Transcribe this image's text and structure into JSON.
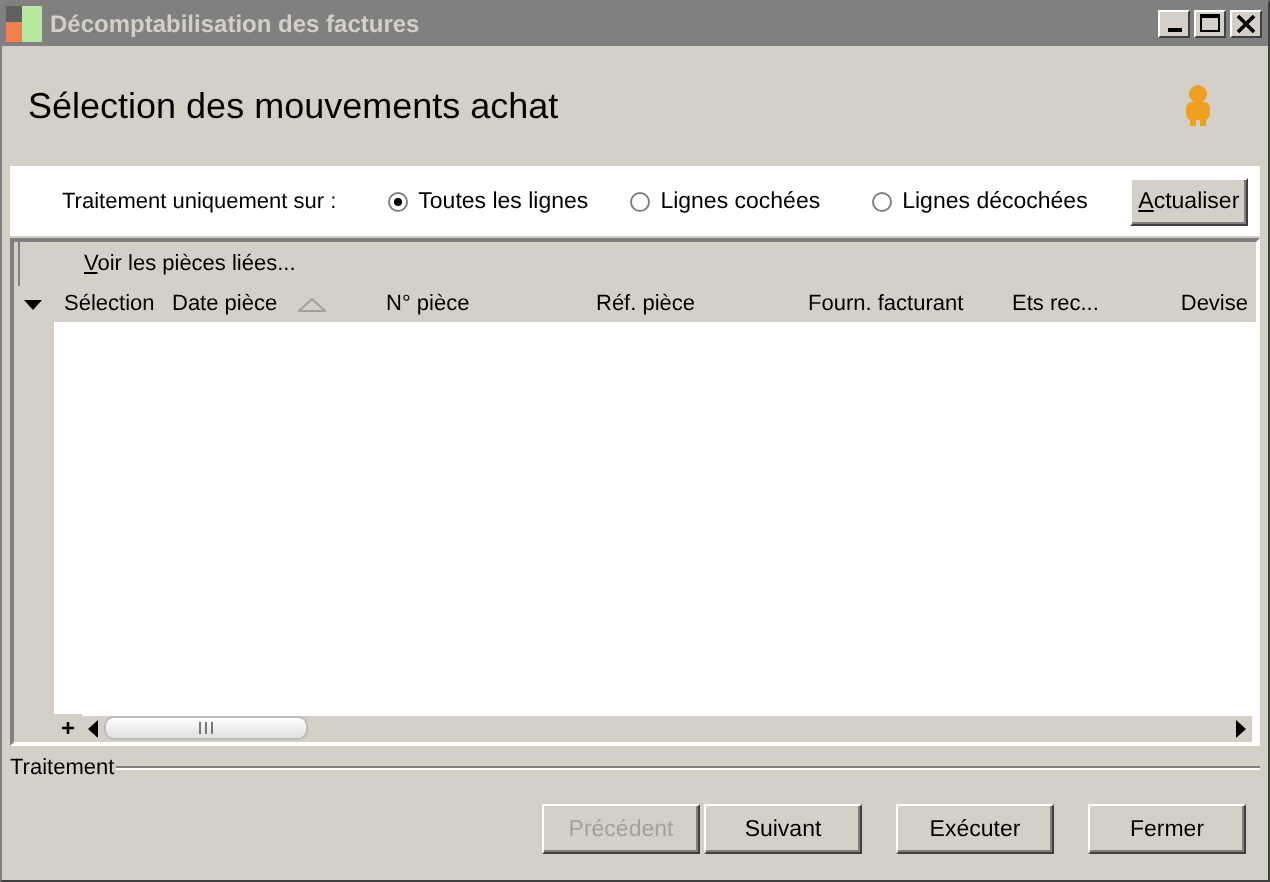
{
  "window": {
    "title": "Décomptabilisation des factures"
  },
  "header": {
    "title": "Sélection des mouvements achat"
  },
  "filter": {
    "label": "Traitement uniquement sur :",
    "options": [
      {
        "label": "Toutes les lignes",
        "selected": true
      },
      {
        "label": "Lignes cochées",
        "selected": false
      },
      {
        "label": "Lignes décochées",
        "selected": false
      }
    ],
    "refresh_button": "Actualiser"
  },
  "grid": {
    "toolbar_link": "Voir les pièces liées...",
    "columns": [
      {
        "label": "Sélection",
        "sorted": false
      },
      {
        "label": "Date pièce",
        "sorted": true
      },
      {
        "label": "N° pièce",
        "sorted": false
      },
      {
        "label": "Réf. pièce",
        "sorted": false
      },
      {
        "label": "Fourn. facturant",
        "sorted": false
      },
      {
        "label": "Ets rec...",
        "sorted": false
      },
      {
        "label": "Devise",
        "sorted": false
      }
    ],
    "add_button": "+"
  },
  "footer": {
    "group_label": "Traitement",
    "buttons": [
      {
        "label": "Précédent",
        "disabled": true
      },
      {
        "label": "Suivant",
        "disabled": false
      },
      {
        "label": "Exécuter",
        "disabled": false
      },
      {
        "label": "Fermer",
        "disabled": false
      }
    ]
  }
}
